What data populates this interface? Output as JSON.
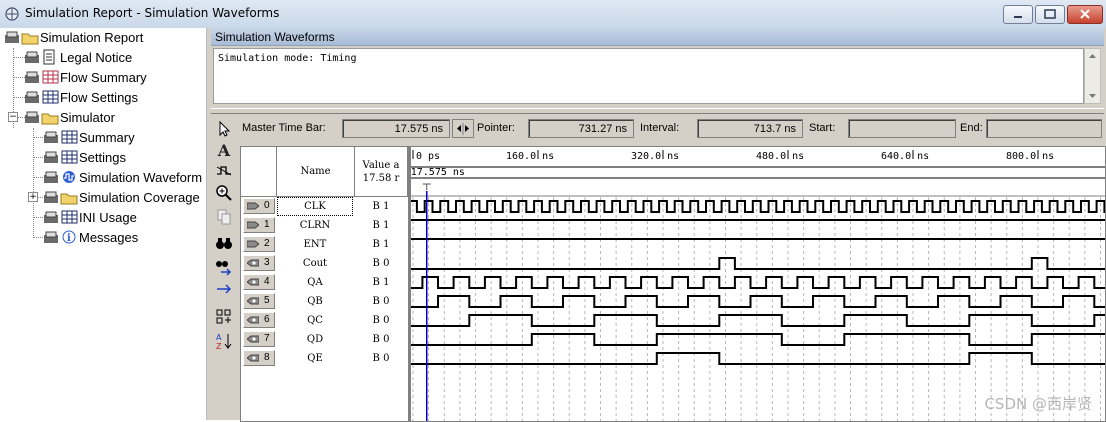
{
  "window": {
    "title": "Simulation Report - Simulation Waveforms"
  },
  "tree": {
    "items": [
      {
        "label": "Simulation Report",
        "icon": "folder-report-icon"
      },
      {
        "label": "Legal Notice",
        "icon": "document-icon"
      },
      {
        "label": "Flow Summary",
        "icon": "table-icon"
      },
      {
        "label": "Flow Settings",
        "icon": "table-icon"
      },
      {
        "label": "Simulator",
        "icon": "folder-icon"
      },
      {
        "label": "Summary",
        "icon": "table-icon"
      },
      {
        "label": "Settings",
        "icon": "table-icon"
      },
      {
        "label": "Simulation Waveform",
        "icon": "waveform-icon"
      },
      {
        "label": "Simulation Coverage",
        "icon": "folder-icon"
      },
      {
        "label": "INI Usage",
        "icon": "table-icon"
      },
      {
        "label": "Messages",
        "icon": "info-icon"
      }
    ]
  },
  "panel": {
    "title": "Simulation Waveforms",
    "message": "Simulation mode: Timing"
  },
  "timebar": {
    "master_label": "Master Time Bar:",
    "master_value": "17.575 ns",
    "pointer_label": "Pointer:",
    "pointer_value": "731.27 ns",
    "interval_label": "Interval:",
    "interval_value": "713.7 ns",
    "start_label": "Start:",
    "start_value": "",
    "end_label": "End:",
    "end_value": ""
  },
  "columns": {
    "name": "Name",
    "value_line1": "Value a",
    "value_line2": "17.58 r"
  },
  "timeline": {
    "ticks": [
      "0 ps",
      "160.0 ns",
      "320.0 ns",
      "480.0 ns",
      "640.0 ns",
      "800.0 ns"
    ],
    "marker_label": "17.575 ns"
  },
  "signals": [
    {
      "index": "0",
      "name": "CLK",
      "value": "B 1",
      "type": "input"
    },
    {
      "index": "1",
      "name": "CLRN",
      "value": "B 1",
      "type": "input"
    },
    {
      "index": "2",
      "name": "ENT",
      "value": "B 1",
      "type": "input"
    },
    {
      "index": "3",
      "name": "Cout",
      "value": "B 0",
      "type": "output"
    },
    {
      "index": "4",
      "name": "QA",
      "value": "B 1",
      "type": "output"
    },
    {
      "index": "5",
      "name": "QB",
      "value": "B 0",
      "type": "output"
    },
    {
      "index": "6",
      "name": "QC",
      "value": "B 0",
      "type": "output"
    },
    {
      "index": "7",
      "name": "QD",
      "value": "B 0",
      "type": "output"
    },
    {
      "index": "8",
      "name": "QE",
      "value": "B 0",
      "type": "output"
    }
  ],
  "watermark": "CSDN @西岸贤",
  "colors": {
    "marker": "#0000c0",
    "titlebar": "#c9d8ea"
  }
}
